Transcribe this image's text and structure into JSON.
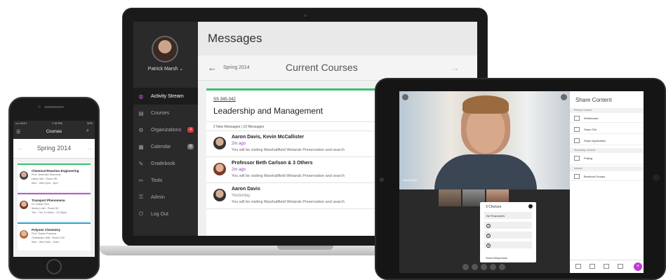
{
  "laptop": {
    "sidebar": {
      "user_name": "Patrick Marsh ⌄",
      "items": [
        {
          "label": "Activity Stream",
          "icon": "globe-icon",
          "active": true
        },
        {
          "label": "Courses",
          "icon": "book-icon"
        },
        {
          "label": "Organizations",
          "icon": "organizations-icon",
          "badge": "4"
        },
        {
          "label": "Calendar",
          "icon": "calendar-icon",
          "badge": "8"
        },
        {
          "label": "Gradebook",
          "icon": "gradebook-icon"
        },
        {
          "label": "Tools",
          "icon": "tools-icon"
        },
        {
          "label": "Admin",
          "icon": "admin-icon"
        },
        {
          "label": "Log Out",
          "icon": "logout-icon"
        }
      ]
    },
    "header": {
      "title": "Messages"
    },
    "subheader": {
      "back": "←",
      "term": "Spring 2014",
      "title": "Current Courses",
      "forward": "→"
    },
    "card": {
      "course_code": "SS 345-342",
      "course_title": "Leadership and Management",
      "message_count": "2 New Messages | 10 Messages",
      "messages": [
        {
          "from": "Aaron Davis, Kevin McCallister",
          "time": "2m ago",
          "time_color": "#9c3fb5",
          "body": "You will be visiting Marshallfield Welands Preservation and search"
        },
        {
          "from": "Professor Beth Carlson & 3 Others",
          "time": "2m ago",
          "time_color": "#9c3fb5",
          "body": "You will be visiting Marshallfield Welands Preservation and search"
        },
        {
          "from": "Aaron Davis",
          "time": "Yesterday",
          "time_color": "#888888",
          "body": "You will be visiting Marshallfield Welands Preservation and search"
        }
      ]
    }
  },
  "phone": {
    "status": {
      "carrier": "•••• AT&T",
      "time": "7:15 PM",
      "battery": "32%"
    },
    "title": "Courses",
    "term": "Spring 2014",
    "courses": [
      {
        "name": "Chemical Reaction Engineering",
        "prof": "Prof. Jeremiah Simmons",
        "room": "Harry Hall - Room 3B",
        "time": "Mon - Wed 2pm - 3pm",
        "accent": "#3bbf74"
      },
      {
        "name": "Transport Phenomena",
        "prof": "Dr. Susan Gou",
        "room": "Monty Lutin - Room 5C",
        "time": "Tue - Thu 11:30am - 12:30pm",
        "accent": "#b55bd1"
      },
      {
        "name": "Polymer Chemistry",
        "prof": "Prof. Susan Fontana",
        "room": "Gulfstream Hall - Room 102",
        "time": "Mon - Wed 9am - 11am",
        "accent": "#2aa7d8"
      }
    ]
  },
  "tablet": {
    "video_caption": "Harry Smith",
    "choices": {
      "title": "3 Choices",
      "no_responses": "No Responses",
      "options": [
        "1",
        "2",
        "3"
      ],
      "footer": "Show Responses"
    },
    "panel": {
      "title": "Share Content",
      "sections": [
        {
          "label": "Primary Content",
          "items": [
            "Whiteboard",
            "Share File",
            "Share Application"
          ]
        },
        {
          "label": "Secondary Content",
          "items": [
            "Polling"
          ]
        },
        {
          "label": "Interact",
          "items": [
            "Breakout Groups"
          ]
        }
      ],
      "fab": "+"
    }
  }
}
